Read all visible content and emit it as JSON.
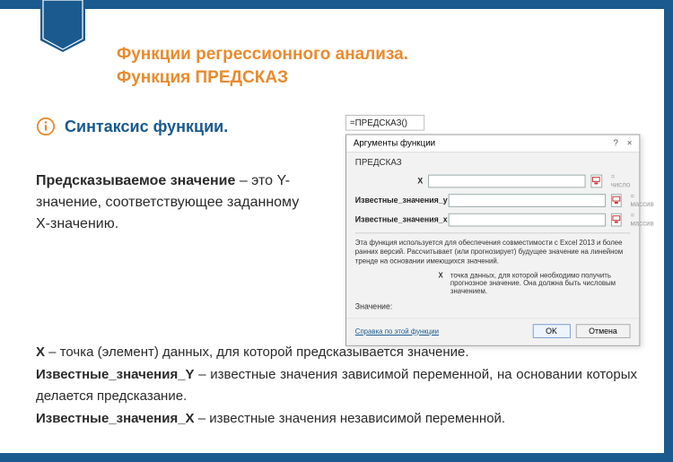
{
  "title_line1": "Функции регрессионного анализа.",
  "title_line2": "Функция ПРЕДСКАЗ",
  "syntax_label": "Синтаксис функции",
  "para1": {
    "bold": "Предсказываемое значение",
    "rest": " – это Y-значение, соответствующее заданному X-значению."
  },
  "bottom": {
    "x_label": "X",
    "x_text": " – точка (элемент) данных, для которой предсказывается значение.",
    "y_label": "Известные_значения_Y",
    "y_text": " – известные значения зависимой переменной, на основании которых делается предсказание.",
    "xs_label": "Известные_значения_X",
    "xs_text": " – известные значения независимой переменной."
  },
  "dialog": {
    "formula": "=ПРЕДСКАЗ()",
    "title": "Аргументы функции",
    "help_sym": "?",
    "close_sym": "×",
    "func_name": "ПРЕДСКАЗ",
    "args": [
      {
        "label": "X",
        "hint": "= число"
      },
      {
        "label": "Известные_значения_y",
        "hint": "= массив"
      },
      {
        "label": "Известные_значения_x",
        "hint": "= массив"
      }
    ],
    "desc": "Эта функция используется для обеспечения совместимости с Excel 2013 и более ранних версий. Рассчитывает (или прогнозирует) будущее значение на линейном тренде на основании имеющихся значений.",
    "arg_focus_label": "X",
    "arg_focus_text": "точка данных, для которой необходимо получить прогнозное значение. Она должна быть числовым значением.",
    "value_label": "Значение:",
    "help_link": "Справка по этой функции",
    "ok": "OK",
    "cancel": "Отмена"
  }
}
